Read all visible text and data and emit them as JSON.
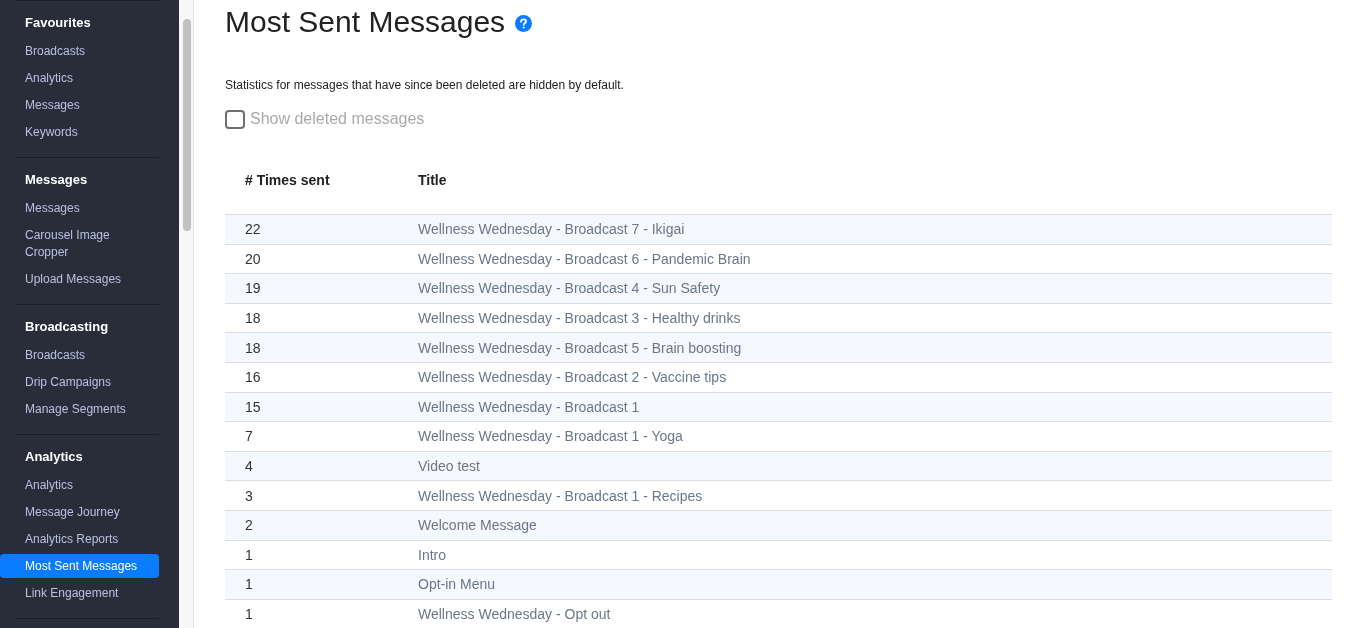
{
  "sidebar": {
    "sections": [
      {
        "title": "Favourites",
        "items": [
          {
            "label": "Broadcasts",
            "selected": false
          },
          {
            "label": "Analytics",
            "selected": false
          },
          {
            "label": "Messages",
            "selected": false
          },
          {
            "label": "Keywords",
            "selected": false
          }
        ]
      },
      {
        "title": "Messages",
        "items": [
          {
            "label": "Messages",
            "selected": false
          },
          {
            "label": "Carousel Image Cropper",
            "selected": false
          },
          {
            "label": "Upload Messages",
            "selected": false
          }
        ]
      },
      {
        "title": "Broadcasting",
        "items": [
          {
            "label": "Broadcasts",
            "selected": false
          },
          {
            "label": "Drip Campaigns",
            "selected": false
          },
          {
            "label": "Manage Segments",
            "selected": false
          }
        ]
      },
      {
        "title": "Analytics",
        "items": [
          {
            "label": "Analytics",
            "selected": false
          },
          {
            "label": "Message Journey",
            "selected": false
          },
          {
            "label": "Analytics Reports",
            "selected": false
          },
          {
            "label": "Most Sent Messages",
            "selected": true
          },
          {
            "label": "Link Engagement",
            "selected": false
          }
        ]
      }
    ]
  },
  "page": {
    "title": "Most Sent Messages",
    "description": "Statistics for messages that have since been deleted are hidden by default.",
    "show_deleted": {
      "label": "Show deleted messages",
      "checked": false
    }
  },
  "table": {
    "columns": [
      "# Times sent",
      "Title"
    ],
    "rows": [
      {
        "times_sent": "22",
        "title": "Wellness Wednesday - Broadcast 7 - Ikigai"
      },
      {
        "times_sent": "20",
        "title": "Wellness Wednesday - Broadcast 6 - Pandemic Brain"
      },
      {
        "times_sent": "19",
        "title": "Wellness Wednesday - Broadcast 4 - Sun Safety"
      },
      {
        "times_sent": "18",
        "title": "Wellness Wednesday - Broadcast 3 - Healthy drinks"
      },
      {
        "times_sent": "18",
        "title": "Wellness Wednesday - Broadcast 5 - Brain boosting"
      },
      {
        "times_sent": "16",
        "title": "Wellness Wednesday - Broadcast 2 - Vaccine tips"
      },
      {
        "times_sent": "15",
        "title": "Wellness Wednesday - Broadcast 1"
      },
      {
        "times_sent": "7",
        "title": "Wellness Wednesday - Broadcast 1 - Yoga"
      },
      {
        "times_sent": "4",
        "title": "Video test"
      },
      {
        "times_sent": "3",
        "title": "Wellness Wednesday - Broadcast 1 - Recipes"
      },
      {
        "times_sent": "2",
        "title": "Welcome Message"
      },
      {
        "times_sent": "1",
        "title": "Intro"
      },
      {
        "times_sent": "1",
        "title": "Opt-in Menu"
      },
      {
        "times_sent": "1",
        "title": "Wellness Wednesday - Opt out"
      }
    ]
  }
}
